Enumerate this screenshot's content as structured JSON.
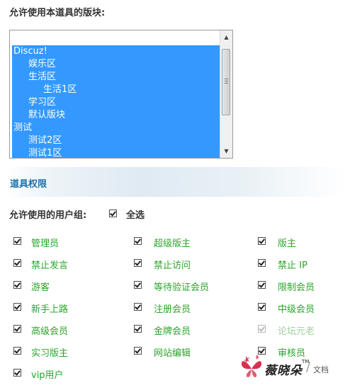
{
  "forums": {
    "label": "允许使用本道具的版块:",
    "options": [
      {
        "label": "Discuz!",
        "level": 0
      },
      {
        "label": "娱乐区",
        "level": 1
      },
      {
        "label": "生活区",
        "level": 1
      },
      {
        "label": "生活1区",
        "level": 2
      },
      {
        "label": "学习区",
        "level": 1
      },
      {
        "label": "默认版块",
        "level": 1
      },
      {
        "label": "测试",
        "level": 0
      },
      {
        "label": "测试2区",
        "level": 1
      },
      {
        "label": "测试1区",
        "level": 1
      }
    ]
  },
  "section": {
    "title": "道具权限"
  },
  "permissions": {
    "groups_label": "允许使用的用户组:",
    "select_all_label": "全选",
    "select_all_checked": true,
    "groups": [
      {
        "label": "管理员",
        "checked": true
      },
      {
        "label": "超级版主",
        "checked": true
      },
      {
        "label": "版主",
        "checked": true
      },
      {
        "label": "禁止发言",
        "checked": true
      },
      {
        "label": "禁止访问",
        "checked": true
      },
      {
        "label": "禁止 IP",
        "checked": true
      },
      {
        "label": "游客",
        "checked": true
      },
      {
        "label": "等待验证会员",
        "checked": true
      },
      {
        "label": "限制会员",
        "checked": true
      },
      {
        "label": "新手上路",
        "checked": true
      },
      {
        "label": "注册会员",
        "checked": true
      },
      {
        "label": "中级会员",
        "checked": true
      },
      {
        "label": "高级会员",
        "checked": true
      },
      {
        "label": "金牌会员",
        "checked": true
      },
      {
        "label": "论坛元老",
        "checked": true
      },
      {
        "label": "实习版主",
        "checked": true
      },
      {
        "label": "网站编辑",
        "checked": true
      },
      {
        "label": "审核员",
        "checked": true
      },
      {
        "label": "vip用户",
        "checked": true
      }
    ]
  },
  "watermark": {
    "brand": "薇晓朵",
    "tm": "TM",
    "sub": "文档"
  }
}
